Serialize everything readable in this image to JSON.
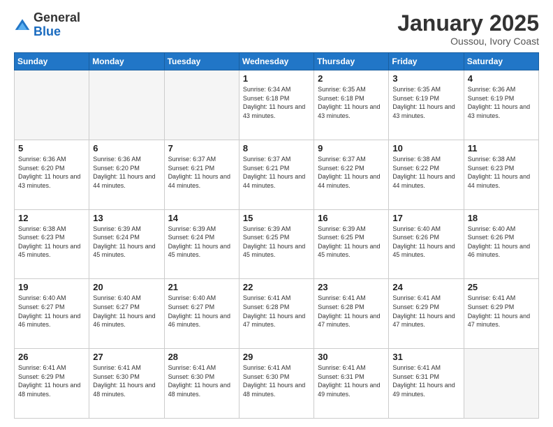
{
  "logo": {
    "general": "General",
    "blue": "Blue"
  },
  "title": {
    "month": "January 2025",
    "location": "Oussou, Ivory Coast"
  },
  "weekdays": [
    "Sunday",
    "Monday",
    "Tuesday",
    "Wednesday",
    "Thursday",
    "Friday",
    "Saturday"
  ],
  "weeks": [
    [
      {
        "day": "",
        "empty": true
      },
      {
        "day": "",
        "empty": true
      },
      {
        "day": "",
        "empty": true
      },
      {
        "day": "1",
        "sunrise": "6:34 AM",
        "sunset": "6:18 PM",
        "daylight": "11 hours and 43 minutes."
      },
      {
        "day": "2",
        "sunrise": "6:35 AM",
        "sunset": "6:18 PM",
        "daylight": "11 hours and 43 minutes."
      },
      {
        "day": "3",
        "sunrise": "6:35 AM",
        "sunset": "6:19 PM",
        "daylight": "11 hours and 43 minutes."
      },
      {
        "day": "4",
        "sunrise": "6:36 AM",
        "sunset": "6:19 PM",
        "daylight": "11 hours and 43 minutes."
      }
    ],
    [
      {
        "day": "5",
        "sunrise": "6:36 AM",
        "sunset": "6:20 PM",
        "daylight": "11 hours and 43 minutes."
      },
      {
        "day": "6",
        "sunrise": "6:36 AM",
        "sunset": "6:20 PM",
        "daylight": "11 hours and 44 minutes."
      },
      {
        "day": "7",
        "sunrise": "6:37 AM",
        "sunset": "6:21 PM",
        "daylight": "11 hours and 44 minutes."
      },
      {
        "day": "8",
        "sunrise": "6:37 AM",
        "sunset": "6:21 PM",
        "daylight": "11 hours and 44 minutes."
      },
      {
        "day": "9",
        "sunrise": "6:37 AM",
        "sunset": "6:22 PM",
        "daylight": "11 hours and 44 minutes."
      },
      {
        "day": "10",
        "sunrise": "6:38 AM",
        "sunset": "6:22 PM",
        "daylight": "11 hours and 44 minutes."
      },
      {
        "day": "11",
        "sunrise": "6:38 AM",
        "sunset": "6:23 PM",
        "daylight": "11 hours and 44 minutes."
      }
    ],
    [
      {
        "day": "12",
        "sunrise": "6:38 AM",
        "sunset": "6:23 PM",
        "daylight": "11 hours and 45 minutes."
      },
      {
        "day": "13",
        "sunrise": "6:39 AM",
        "sunset": "6:24 PM",
        "daylight": "11 hours and 45 minutes."
      },
      {
        "day": "14",
        "sunrise": "6:39 AM",
        "sunset": "6:24 PM",
        "daylight": "11 hours and 45 minutes."
      },
      {
        "day": "15",
        "sunrise": "6:39 AM",
        "sunset": "6:25 PM",
        "daylight": "11 hours and 45 minutes."
      },
      {
        "day": "16",
        "sunrise": "6:39 AM",
        "sunset": "6:25 PM",
        "daylight": "11 hours and 45 minutes."
      },
      {
        "day": "17",
        "sunrise": "6:40 AM",
        "sunset": "6:26 PM",
        "daylight": "11 hours and 45 minutes."
      },
      {
        "day": "18",
        "sunrise": "6:40 AM",
        "sunset": "6:26 PM",
        "daylight": "11 hours and 46 minutes."
      }
    ],
    [
      {
        "day": "19",
        "sunrise": "6:40 AM",
        "sunset": "6:27 PM",
        "daylight": "11 hours and 46 minutes."
      },
      {
        "day": "20",
        "sunrise": "6:40 AM",
        "sunset": "6:27 PM",
        "daylight": "11 hours and 46 minutes."
      },
      {
        "day": "21",
        "sunrise": "6:40 AM",
        "sunset": "6:27 PM",
        "daylight": "11 hours and 46 minutes."
      },
      {
        "day": "22",
        "sunrise": "6:41 AM",
        "sunset": "6:28 PM",
        "daylight": "11 hours and 47 minutes."
      },
      {
        "day": "23",
        "sunrise": "6:41 AM",
        "sunset": "6:28 PM",
        "daylight": "11 hours and 47 minutes."
      },
      {
        "day": "24",
        "sunrise": "6:41 AM",
        "sunset": "6:29 PM",
        "daylight": "11 hours and 47 minutes."
      },
      {
        "day": "25",
        "sunrise": "6:41 AM",
        "sunset": "6:29 PM",
        "daylight": "11 hours and 47 minutes."
      }
    ],
    [
      {
        "day": "26",
        "sunrise": "6:41 AM",
        "sunset": "6:29 PM",
        "daylight": "11 hours and 48 minutes."
      },
      {
        "day": "27",
        "sunrise": "6:41 AM",
        "sunset": "6:30 PM",
        "daylight": "11 hours and 48 minutes."
      },
      {
        "day": "28",
        "sunrise": "6:41 AM",
        "sunset": "6:30 PM",
        "daylight": "11 hours and 48 minutes."
      },
      {
        "day": "29",
        "sunrise": "6:41 AM",
        "sunset": "6:30 PM",
        "daylight": "11 hours and 48 minutes."
      },
      {
        "day": "30",
        "sunrise": "6:41 AM",
        "sunset": "6:31 PM",
        "daylight": "11 hours and 49 minutes."
      },
      {
        "day": "31",
        "sunrise": "6:41 AM",
        "sunset": "6:31 PM",
        "daylight": "11 hours and 49 minutes."
      },
      {
        "day": "",
        "empty": true
      }
    ]
  ]
}
